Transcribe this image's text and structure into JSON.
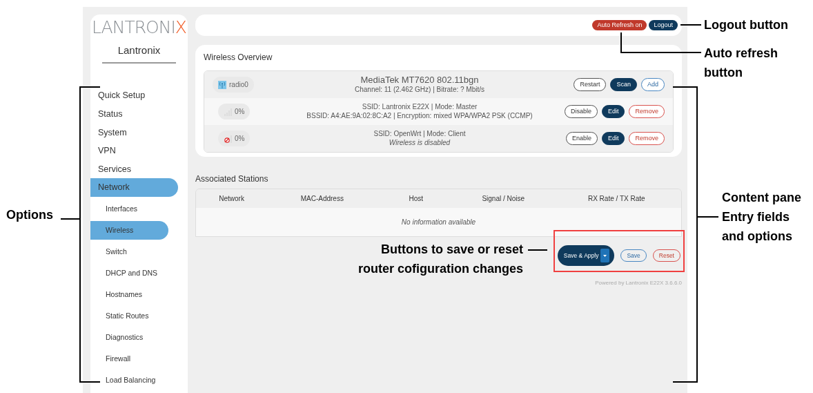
{
  "sidebar": {
    "logo": {
      "text": "LANTRONI",
      "accent": "X"
    },
    "brand": "Lantronix",
    "items": [
      {
        "label": "Quick Setup",
        "selected": false
      },
      {
        "label": "Status",
        "selected": false
      },
      {
        "label": "System",
        "selected": false
      },
      {
        "label": "VPN",
        "selected": false
      },
      {
        "label": "Services",
        "selected": false
      },
      {
        "label": "Network",
        "selected": true,
        "children": [
          {
            "label": "Interfaces",
            "selected": false
          },
          {
            "label": "Wireless",
            "selected": true
          },
          {
            "label": "Switch",
            "selected": false
          },
          {
            "label": "DHCP and DNS",
            "selected": false
          },
          {
            "label": "Hostnames",
            "selected": false
          },
          {
            "label": "Static Routes",
            "selected": false
          },
          {
            "label": "Diagnostics",
            "selected": false
          },
          {
            "label": "Firewall",
            "selected": false
          },
          {
            "label": "Load Balancing",
            "selected": false
          }
        ]
      }
    ]
  },
  "header": {
    "auto_refresh": "Auto Refresh on",
    "logout": "Logout"
  },
  "wireless_overview": {
    "title": "Wireless Overview",
    "rows": [
      {
        "kind": "radio",
        "badge": "radio0",
        "title": "MediaTek MT7620 802.11bgn",
        "detail": "Channel: 11 (2.462 GHz) | Bitrate: ? Mbit/s",
        "buttons": [
          {
            "label": "Restart",
            "kind": "outline"
          },
          {
            "label": "Scan",
            "kind": "primary"
          },
          {
            "label": "Add",
            "kind": "info"
          }
        ]
      },
      {
        "kind": "network",
        "badge": "0%",
        "title": "SSID: Lantronix E22X | Mode: Master",
        "detail": "BSSID: A4:AE:9A:02:8C:A2 | Encryption: mixed WPA/WPA2 PSK (CCMP)",
        "disabled": false,
        "buttons": [
          {
            "label": "Disable",
            "kind": "outline"
          },
          {
            "label": "Edit",
            "kind": "primary"
          },
          {
            "label": "Remove",
            "kind": "danger"
          }
        ]
      },
      {
        "kind": "network",
        "badge": "0%",
        "title": "SSID: OpenWrt | Mode: Client",
        "detail": "Wireless is disabled",
        "disabled": true,
        "buttons": [
          {
            "label": "Enable",
            "kind": "outline"
          },
          {
            "label": "Edit",
            "kind": "primary"
          },
          {
            "label": "Remove",
            "kind": "danger"
          }
        ]
      }
    ]
  },
  "associated_stations": {
    "title": "Associated Stations",
    "columns": [
      "Network",
      "MAC-Address",
      "Host",
      "Signal / Noise",
      "RX Rate / TX Rate"
    ],
    "empty": "No information available"
  },
  "actions": {
    "save_apply": "Save & Apply",
    "save": "Save",
    "reset": "Reset"
  },
  "footer": "Powered by Lantronix E22X 3.6.6.0",
  "annotations": {
    "logout": "Logout button",
    "auto_refresh": [
      "Auto refresh",
      "button"
    ],
    "options": "Options",
    "content": [
      "Content pane",
      "Entry fields",
      "and options"
    ],
    "save": [
      "Buttons to save or reset",
      "router cofiguration changes"
    ]
  }
}
